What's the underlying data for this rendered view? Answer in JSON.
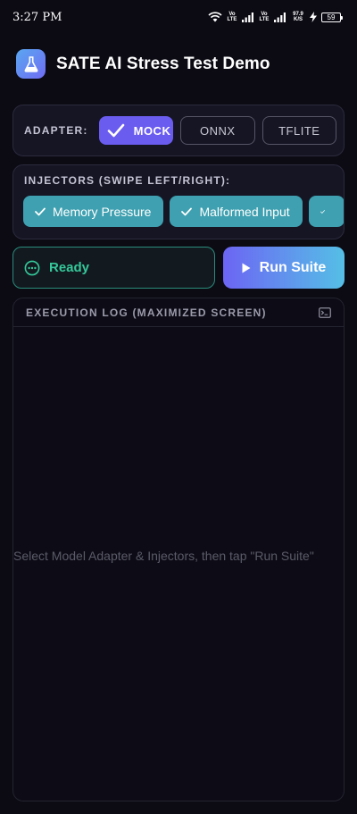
{
  "status_bar": {
    "time": "3:27 PM",
    "volte_1": "Vo LTE",
    "volte_2": "Vo LTE",
    "speed": "97.9 K/S",
    "battery": "59"
  },
  "header": {
    "title": "SATE AI Stress Test Demo",
    "logo_icon": "flask-icon"
  },
  "adapter": {
    "label": "ADAPTER:",
    "options": [
      {
        "label": "MOCK",
        "selected": true
      },
      {
        "label": "ONNX",
        "selected": false
      },
      {
        "label": "TFLITE",
        "selected": false
      }
    ]
  },
  "injectors": {
    "label": "INJECTORS (SWIPE LEFT/RIGHT):",
    "chips": [
      {
        "label": "Memory Pressure",
        "selected": true
      },
      {
        "label": "Malformed Input",
        "selected": true
      }
    ]
  },
  "status": {
    "text": "Ready",
    "color": "#35c89a"
  },
  "run": {
    "label": "Run Suite"
  },
  "log": {
    "title": "EXECUTION LOG (MAXIMIZED SCREEN)",
    "placeholder": "Select Model Adapter & Injectors, then tap \"Run Suite\""
  },
  "colors": {
    "background": "#0c0b14",
    "accent": "#6b5cf0",
    "chip": "#3ea0b0",
    "run_gradient_start": "#6c65f4",
    "run_gradient_end": "#55bfe6"
  }
}
